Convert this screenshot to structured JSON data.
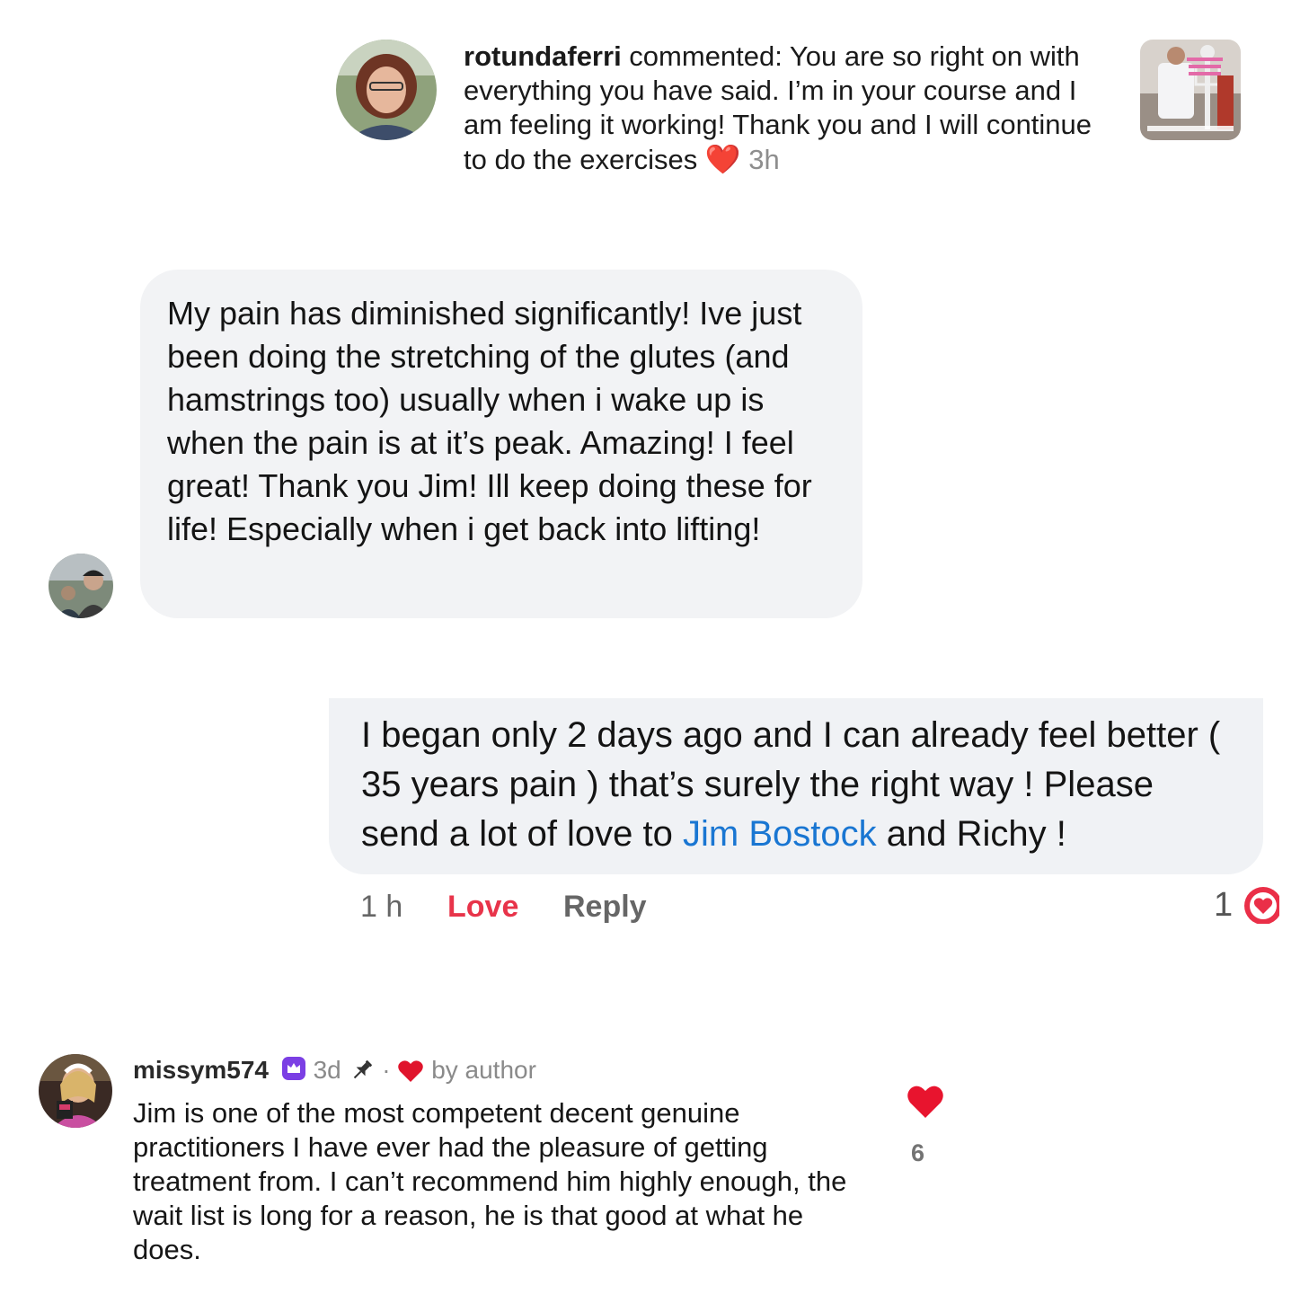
{
  "notification": {
    "username": "rotundaferri",
    "text": " commented: You are so right on with everything you have said. I’m in your course and I am feeling it working!  Thank you and I will continue to do the exercises ",
    "emoji": "❤️",
    "time": "3h"
  },
  "message1": {
    "text": "My pain has diminished significantly! Ive just been doing the stretching of the glutes (and hamstrings too)  usually when i wake up is when the pain is at it’s peak. Amazing! I feel great! Thank you Jim! Ill keep doing these for life! Especially when i get back into lifting!"
  },
  "message2": {
    "text_before": "I began only 2 days ago and I can already feel better ( 35 years pain ) that’s surely the right way ! Please send a lot of love to ",
    "mention": "Jim Bostock",
    "text_after": " and Richy !"
  },
  "actions": {
    "time": "1 h",
    "love": "Love",
    "reply": "Reply",
    "reaction_count": "1"
  },
  "comment": {
    "username": "missym574",
    "age": "3d",
    "separator": "·",
    "liked_by": "by author",
    "text": "Jim is one of the most competent decent genuine practitioners I have ever had the pleasure of getting treatment from. I can’t recommend him highly enough, the wait list is long for a reason, he is that good at what he does.",
    "like_count": "6"
  },
  "colors": {
    "accent_red": "#e8344a",
    "mention_blue": "#1976d2",
    "creator_badge": "#7b3fe4",
    "bubble_gray": "#f2f3f5"
  }
}
